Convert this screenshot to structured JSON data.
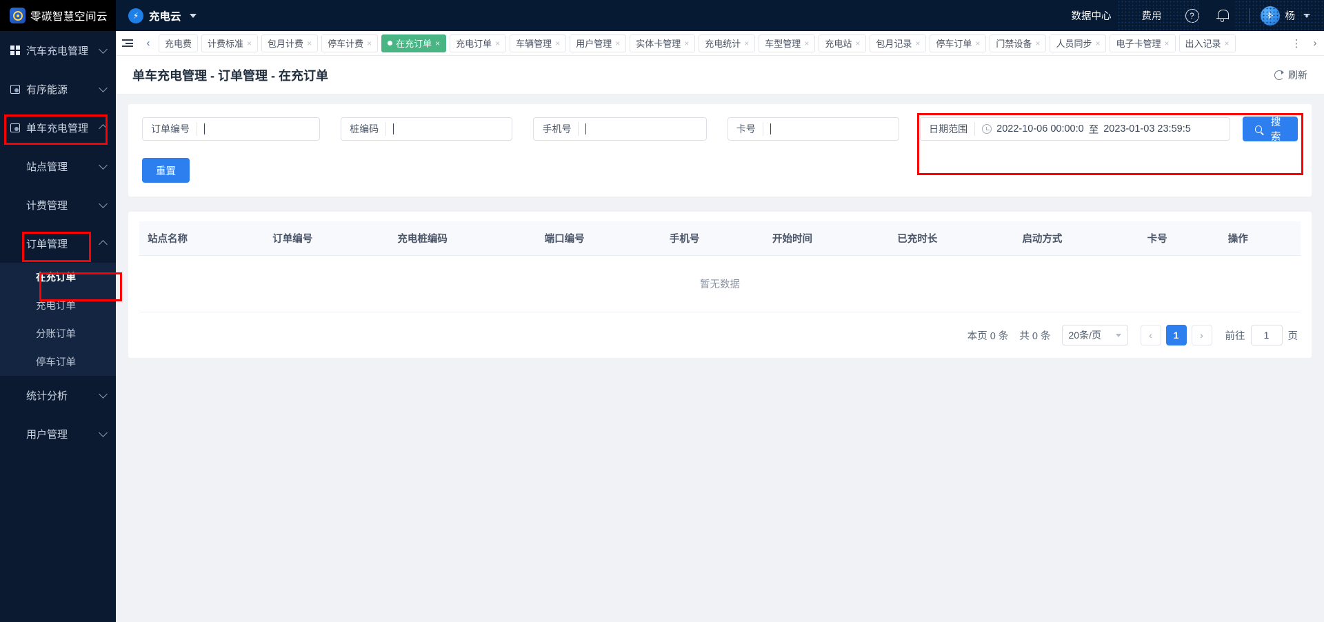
{
  "header": {
    "brand_name": "零碳智慧空间云",
    "app_name": "充电云",
    "links": [
      {
        "label": "数据中心"
      },
      {
        "label": "费用"
      }
    ],
    "help_icon": "?",
    "user_name": "杨",
    "accent": "#2d7ff0"
  },
  "sidebar": {
    "items": [
      {
        "label": "汽车充电管理",
        "icon": "grid-icon",
        "expanded": false
      },
      {
        "label": "有序能源",
        "icon": "square-icon",
        "expanded": false
      },
      {
        "label": "单车充电管理",
        "icon": "square-icon",
        "expanded": true,
        "highlight": true
      }
    ],
    "groups": [
      {
        "label": "站点管理",
        "expanded": false
      },
      {
        "label": "计费管理",
        "expanded": false
      },
      {
        "label": "订单管理",
        "expanded": true,
        "highlight": true
      }
    ],
    "order_children": [
      {
        "label": "在充订单",
        "active": true,
        "highlight": true
      },
      {
        "label": "充电订单",
        "active": false
      },
      {
        "label": "分账订单",
        "active": false
      },
      {
        "label": "停车订单",
        "active": false
      }
    ],
    "tail_groups": [
      {
        "label": "统计分析",
        "expanded": false
      },
      {
        "label": "用户管理",
        "expanded": false
      }
    ]
  },
  "tabs": [
    {
      "label": "充电费",
      "closable": false,
      "active": false
    },
    {
      "label": "计费标准",
      "closable": true,
      "active": false
    },
    {
      "label": "包月计费",
      "closable": true,
      "active": false
    },
    {
      "label": "停车计费",
      "closable": true,
      "active": false
    },
    {
      "label": "在充订单",
      "closable": true,
      "active": true
    },
    {
      "label": "充电订单",
      "closable": true,
      "active": false
    },
    {
      "label": "车辆管理",
      "closable": true,
      "active": false
    },
    {
      "label": "用户管理",
      "closable": true,
      "active": false
    },
    {
      "label": "实体卡管理",
      "closable": true,
      "active": false
    },
    {
      "label": "充电统计",
      "closable": true,
      "active": false
    },
    {
      "label": "车型管理",
      "closable": true,
      "active": false
    },
    {
      "label": "充电站",
      "closable": true,
      "active": false
    },
    {
      "label": "包月记录",
      "closable": true,
      "active": false
    },
    {
      "label": "停车订单",
      "closable": true,
      "active": false
    },
    {
      "label": "门禁设备",
      "closable": true,
      "active": false
    },
    {
      "label": "人员同步",
      "closable": true,
      "active": false
    },
    {
      "label": "电子卡管理",
      "closable": true,
      "active": false
    },
    {
      "label": "出入记录",
      "closable": true,
      "active": false
    }
  ],
  "page": {
    "title": "单车充电管理 - 订单管理 - 在充订单",
    "refresh_label": "刷新"
  },
  "filters": {
    "order_no": {
      "label": "订单编号",
      "value": "",
      "placeholder": ""
    },
    "pile_no": {
      "label": "桩编码",
      "value": "",
      "placeholder": ""
    },
    "phone": {
      "label": "手机号",
      "value": "",
      "placeholder": ""
    },
    "card_no": {
      "label": "卡号",
      "value": "",
      "placeholder": ""
    },
    "date_range": {
      "label": "日期范围",
      "start": "2022-10-06 00:00:0",
      "separator": "至",
      "end": "2023-01-03 23:59:5"
    },
    "search_label": "搜索",
    "reset_label": "重置"
  },
  "table": {
    "columns": [
      "站点名称",
      "订单编号",
      "充电桩编码",
      "端口编号",
      "手机号",
      "开始时间",
      "已充时长",
      "启动方式",
      "卡号",
      "操作"
    ],
    "rows": [],
    "empty_text": "暂无数据"
  },
  "pagination": {
    "page_count_text": "本页 0 条",
    "total_text": "共 0 条",
    "page_size": "20条/页",
    "prev": "‹",
    "next": "›",
    "current_page": "1",
    "goto_label": "前往",
    "goto_value": "1",
    "goto_unit": "页"
  }
}
